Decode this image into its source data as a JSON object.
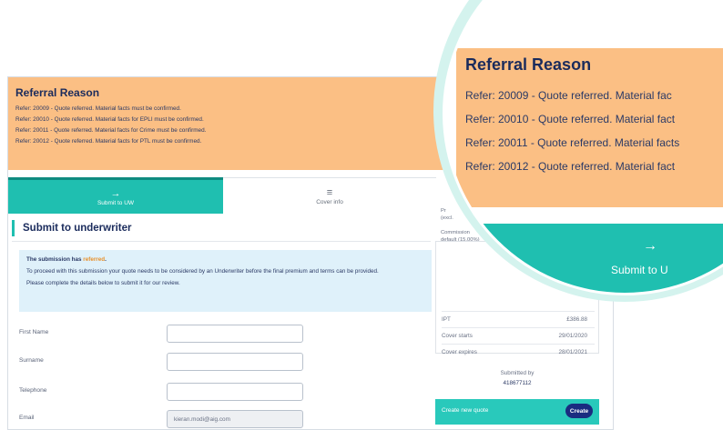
{
  "referral": {
    "title": "Referral Reason",
    "lines": [
      "Refer: 20009 - Quote referred. Material facts must be confirmed.",
      "Refer: 20010 - Quote referred. Material facts for EPLI must be confirmed.",
      "Refer: 20011 - Quote referred. Material facts for Crime must be confirmed.",
      "Refer: 20012 - Quote referred. Material facts for PTL must be confirmed."
    ]
  },
  "tabs": {
    "submit": {
      "label": "Submit to UW",
      "icon": "arrow-right-icon"
    },
    "cover": {
      "label": "Cover info",
      "icon": "list-icon"
    }
  },
  "section": {
    "title": "Submit to underwriter"
  },
  "info": {
    "status_prefix": "The submission has",
    "status_word": "referred",
    "status_suffix": ".",
    "body": "To proceed with this submission your quote needs to be considered by an Underwriter before the final premium and terms can be provided.",
    "instruction": "Please complete the details below to submit it for our review."
  },
  "form": {
    "first_name_label": "First Name",
    "surname_label": "Surname",
    "telephone_label": "Telephone",
    "email_label": "Email",
    "email_value": "kieran.modi@aig.com"
  },
  "summary": {
    "commission_label": "Commission",
    "commission_sub": "default (15.00%)",
    "premium_label": "Pr",
    "premium_sub": "(excl.",
    "ipt_label": "IPT",
    "ipt_value": "£386.88",
    "cover_starts_label": "Cover starts",
    "cover_starts_value": "29/01/2020",
    "cover_expires_label": "Cover expires",
    "cover_expires_value": "28/01/2021",
    "submitted_by_label": "Submitted by",
    "submitted_by_value": "418677112",
    "create_new_label": "Create new quote",
    "create_button": "Create"
  },
  "magnifier": {
    "title": "Referral Reason",
    "lines": [
      "Refer: 20009 - Quote referred. Material fac",
      "Refer: 20010 - Quote referred. Material fact",
      "Refer: 20011 - Quote referred. Material facts",
      "Refer: 20012 - Quote referred. Material fact"
    ],
    "tab_label": "Submit to U",
    "tab_icon": "arrow-right-icon"
  },
  "colors": {
    "referral_bg": "#fbbf84",
    "teal": "#1fbfb0",
    "navy": "#1a2b5c",
    "info_bg": "#dff1fa",
    "accent_orange": "#e8902a",
    "create_button_bg": "#1a2c80"
  }
}
